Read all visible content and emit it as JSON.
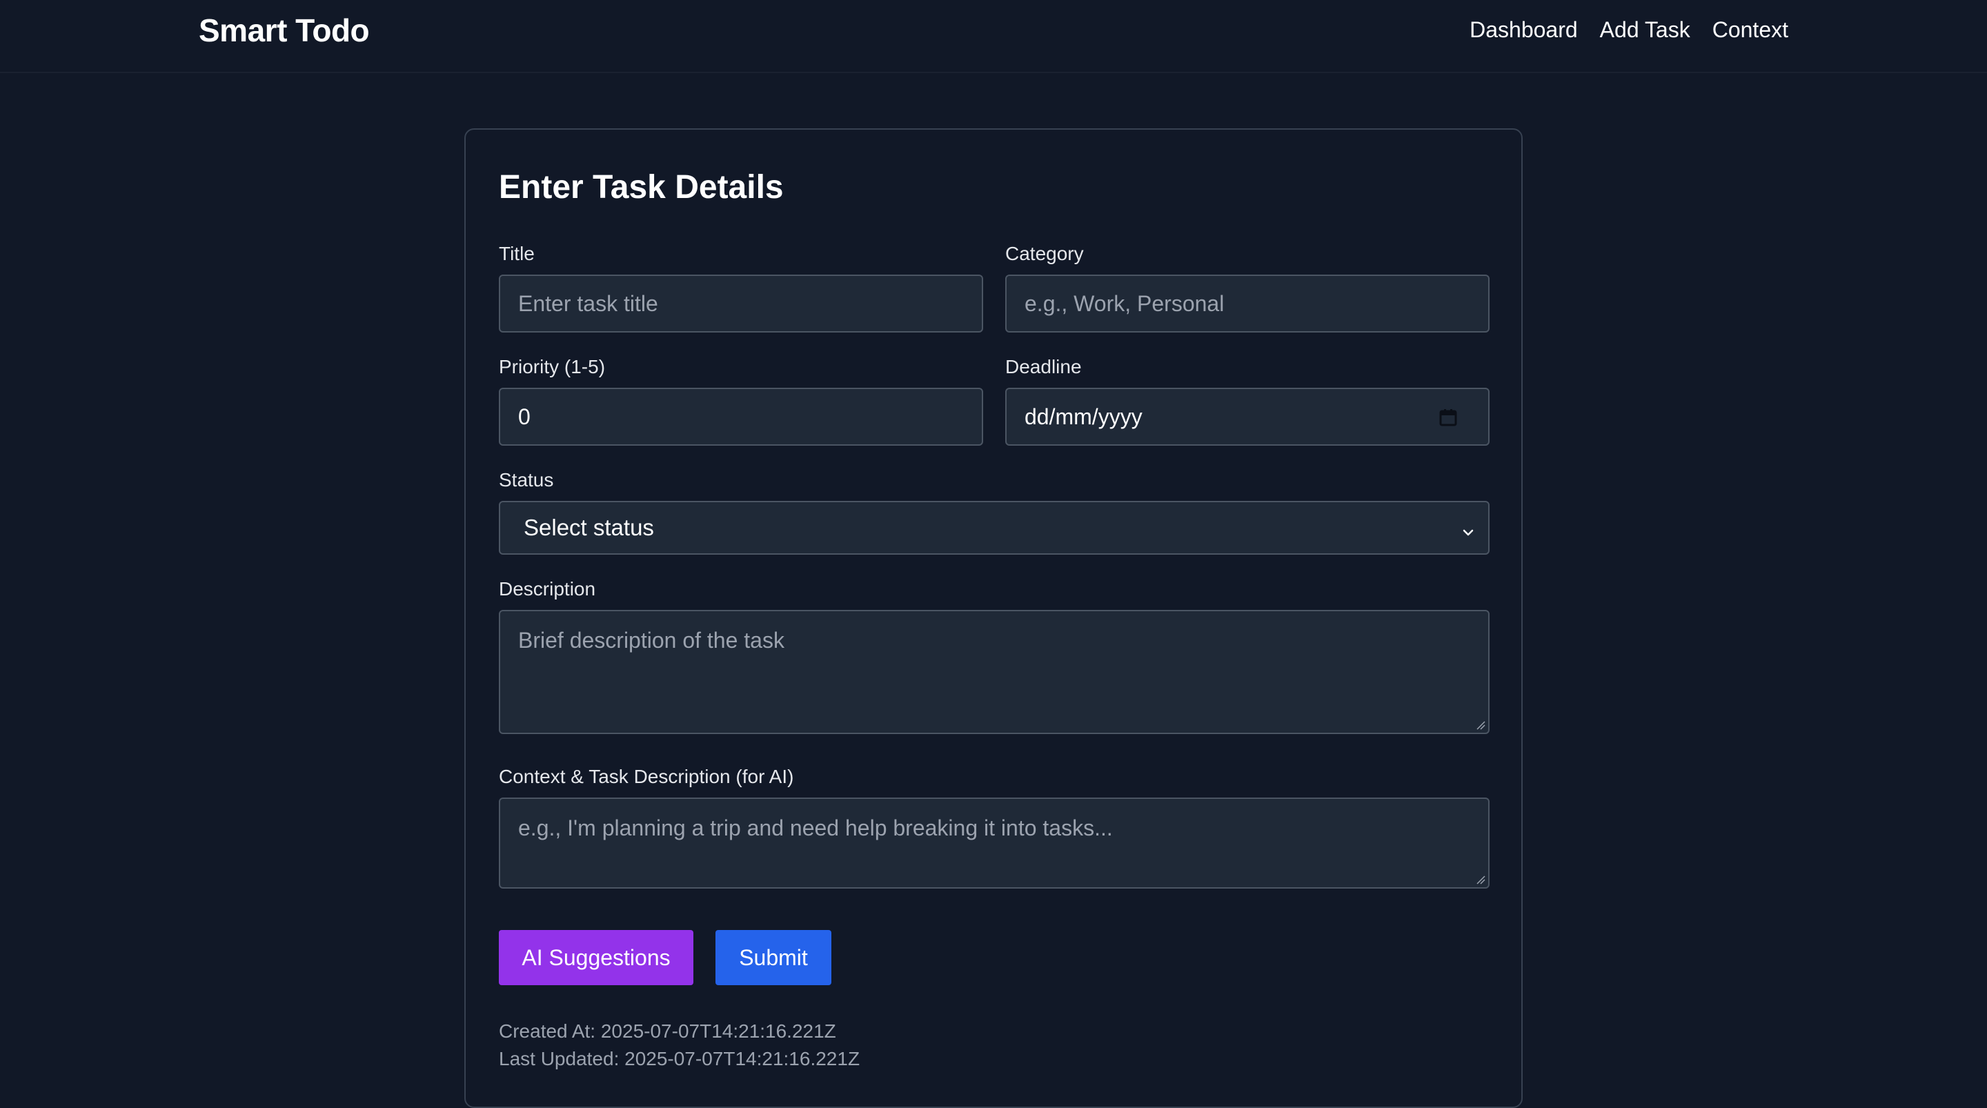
{
  "navbar": {
    "brand": "Smart Todo",
    "links": [
      "Dashboard",
      "Add Task",
      "Context"
    ]
  },
  "form": {
    "heading": "Enter Task Details",
    "title": {
      "label": "Title",
      "placeholder": "Enter task title"
    },
    "category": {
      "label": "Category",
      "placeholder": "e.g., Work, Personal"
    },
    "priority": {
      "label": "Priority (1-5)",
      "value": "0"
    },
    "deadline": {
      "label": "Deadline",
      "value": "dd/mm/yyyy",
      "icon": "calendar-icon"
    },
    "status": {
      "label": "Status",
      "selected": "Select status",
      "icon": "chevron-down-icon"
    },
    "description": {
      "label": "Description",
      "placeholder": "Brief description of the task"
    },
    "context": {
      "label": "Context & Task Description (for AI)",
      "placeholder": "e.g., I'm planning a trip and need help breaking it into tasks..."
    },
    "buttons": {
      "ai_suggestions": "AI Suggestions",
      "submit": "Submit"
    },
    "meta": {
      "created_at": "Created At: 2025-07-07T14:21:16.221Z",
      "last_updated": "Last Updated: 2025-07-07T14:21:16.221Z"
    }
  },
  "colors": {
    "background": "#111827",
    "input_background": "#1f2937",
    "border": "#4b5563",
    "ai_button": "#9333ea",
    "submit_button": "#2563eb"
  }
}
